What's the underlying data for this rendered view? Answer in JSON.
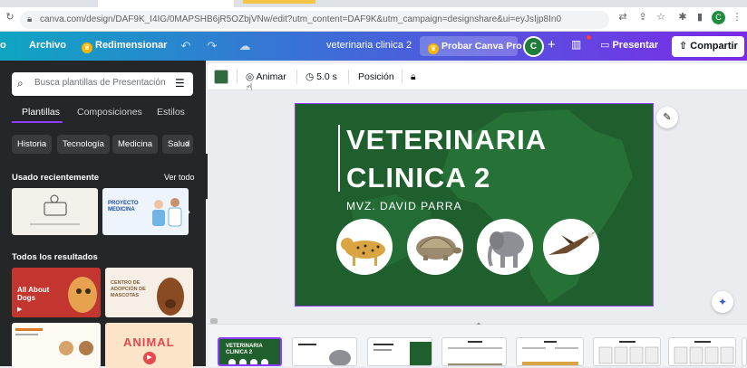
{
  "browser": {
    "url": "canva.com/design/DAF9K_I4IG/0MAPSHB6jR5OZbjVNw/edit?utm_content=DAF9K&utm_campaign=designshare&ui=eyJsIjp8In0",
    "avatar_letter": "C"
  },
  "topbar": {
    "file_label": "Archivo",
    "resize_label": "Redimensionar",
    "doc_title": "veterinaria clinica 2",
    "pro_label": "Probar Canva Pro",
    "avatar_letter": "C",
    "present_label": "Presentar",
    "share_label": "Compartir"
  },
  "panel": {
    "search_placeholder": "Busca plantillas de Presentación",
    "tabs": [
      "Plantillas",
      "Composiciones",
      "Estilos"
    ],
    "chips": [
      "Historia",
      "Tecnología",
      "Medicina",
      "Salud"
    ],
    "recent_title": "Usado recientemente",
    "see_all": "Ver todo",
    "all_results_title": "Todos los resultados",
    "thumb_labels": [
      "PROYECTO MEDICINA",
      "All About Dogs",
      "CENTRO DE ADOPCIÓN DE MASCOTAS",
      "ANIMAL"
    ]
  },
  "toolbar": {
    "animate_label": "Animar",
    "duration_label": "5.0 s",
    "position_label": "Posición"
  },
  "slide": {
    "title_line1": "VETERINARIA",
    "title_line2": "CLINICA 2",
    "subtitle": "MVZ. DAVID PARRA",
    "bg_color": "#1f5f2e",
    "animals": [
      "leopard",
      "tortoise",
      "elephant",
      "eagle"
    ]
  },
  "pages": {
    "first_label": "VETERINARIA CLINICA 2"
  },
  "colors": {
    "accent": "#8b3dff",
    "panel_bg": "#252627",
    "slide_green": "#1f5f2e"
  }
}
